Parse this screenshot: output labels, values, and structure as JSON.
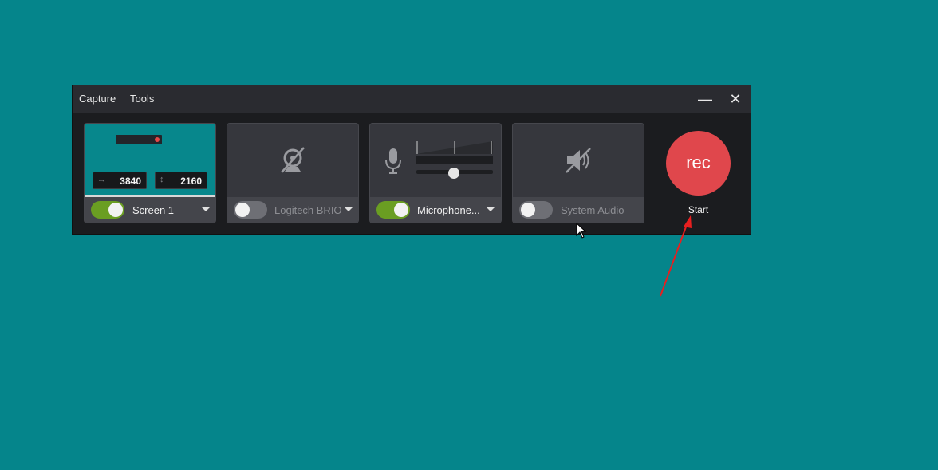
{
  "menu": {
    "capture": "Capture",
    "tools": "Tools"
  },
  "window": {
    "minimize": "—",
    "close": "✕"
  },
  "screen_panel": {
    "width_value": "3840",
    "height_value": "2160",
    "label": "Screen 1",
    "enabled": true
  },
  "camera_panel": {
    "label": "Logitech BRIO",
    "enabled": false
  },
  "mic_panel": {
    "label": "Microphone...",
    "enabled": true,
    "volume_level": 0.5
  },
  "system_audio_panel": {
    "label": "System Audio",
    "enabled": false
  },
  "record": {
    "button_label": "rec",
    "start_label": "Start"
  },
  "colors": {
    "background": "#05858b",
    "accent_green": "#6a9e22",
    "record_red": "#e0474c",
    "annotation_arrow": "#e81f1f"
  }
}
